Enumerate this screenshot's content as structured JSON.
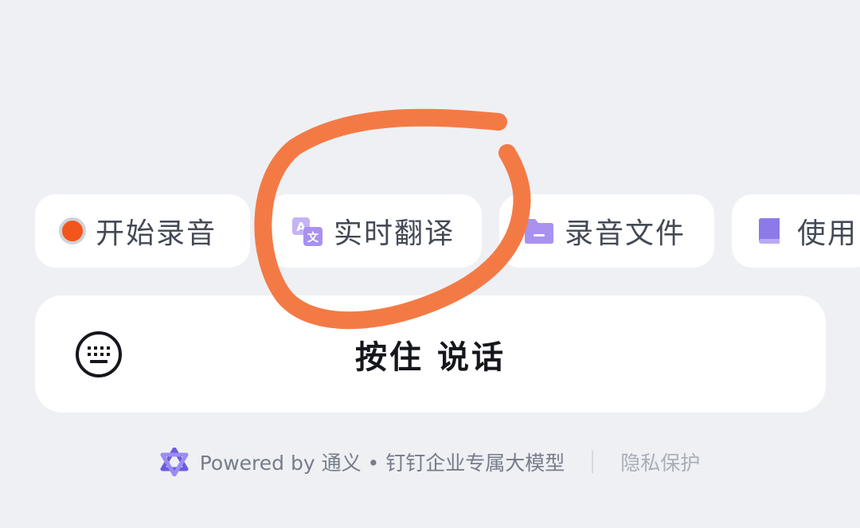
{
  "chips": [
    {
      "label": "开始录音",
      "icon": "record-dot-icon"
    },
    {
      "label": "实时翻译",
      "icon": "translate-icon"
    },
    {
      "label": "录音文件",
      "icon": "folder-icon"
    },
    {
      "label": "使用",
      "icon": "book-icon"
    }
  ],
  "talk": {
    "label": "按住 说话",
    "icon": "keyboard-icon"
  },
  "footer": {
    "powered": "Powered by 通义 • 钉钉企业专属大模型",
    "privacy": "隐私保护"
  },
  "colors": {
    "background": "#eef0f4",
    "record": "#f2561d",
    "accent_purple": "#a991f0",
    "annotation": "#f47a45"
  }
}
